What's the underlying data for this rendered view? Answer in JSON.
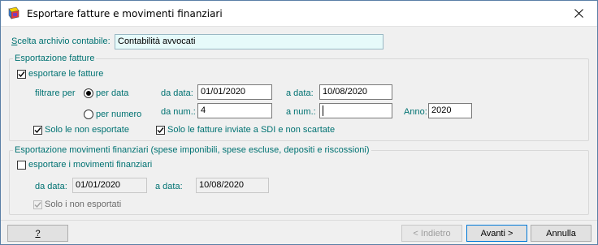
{
  "window": {
    "title": "Esportare fatture e movimenti finanziari"
  },
  "archive": {
    "label": "Scelta archivio contabile:",
    "value": "Contabilità avvocati"
  },
  "invoices": {
    "group_title": "Esportazione fatture",
    "export_checkbox": {
      "label": "esportare le fatture",
      "checked": true
    },
    "filter_label": "filtrare per",
    "radio_date": "per data",
    "radio_number": "per numero",
    "from_date_label": "da data:",
    "from_date": "01/01/2020",
    "to_date_label": "a data:",
    "to_date": "10/08/2020",
    "from_num_label": "da num.:",
    "from_num": "4",
    "to_num_label": "a num.:",
    "to_num": "",
    "year_label": "Anno:",
    "year": "2020",
    "only_not_exported": "Solo le non esportate",
    "only_sdi": "Solo le fatture inviate a SDI e non scartate"
  },
  "movements": {
    "group_title": "Esportazione movimenti finanziari (spese imponibili, spese escluse, depositi e riscossioni)",
    "export_checkbox": {
      "label": "esportare i movimenti finanziari",
      "checked": false
    },
    "from_date_label": "da data:",
    "from_date": "01/01/2020",
    "to_date_label": "a data:",
    "to_date": "10/08/2020",
    "only_not_exported": "Solo i non esportati"
  },
  "footer": {
    "help": "?",
    "back": "< Indietro",
    "next": "Avanti >",
    "cancel": "Annulla"
  },
  "colors": {
    "accent_text": "#007272",
    "focus_border": "#0078d7",
    "archive_field_bg": "#e6fafa"
  }
}
